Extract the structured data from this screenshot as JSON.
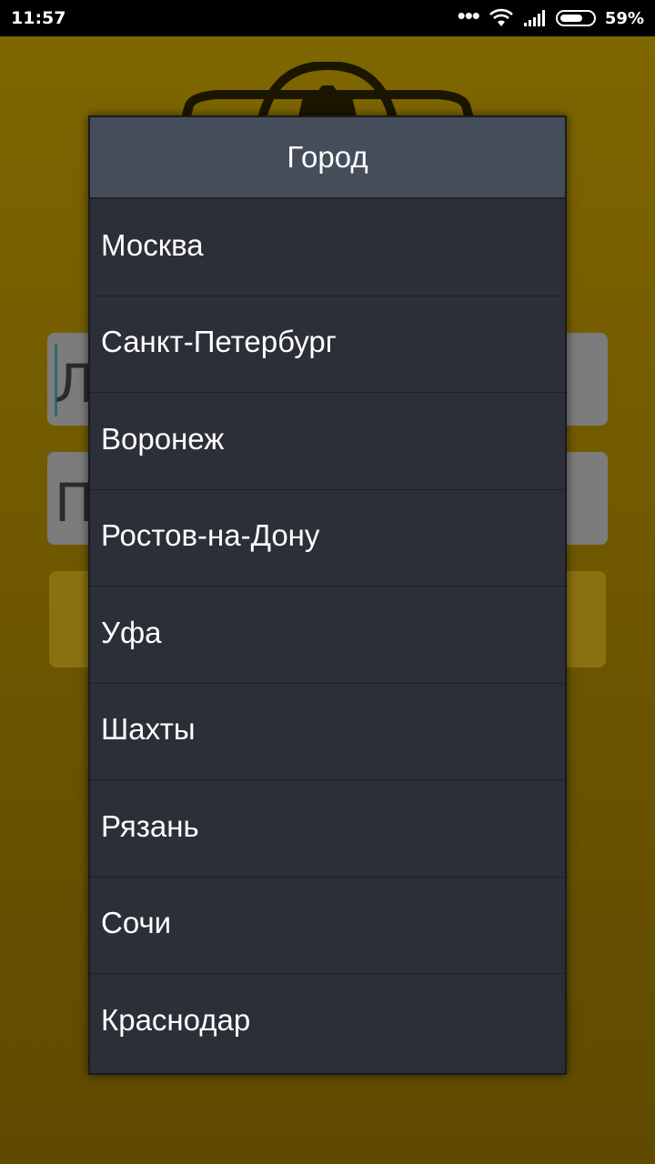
{
  "status_bar": {
    "time": "11:57",
    "battery_percent": "59%",
    "battery_level": 0.59
  },
  "background_app": {
    "login_field_partial": "Л",
    "password_field_partial": "П"
  },
  "dialog": {
    "title": "Город",
    "cities": [
      "Москва",
      "Санкт-Петербург",
      "Воронеж",
      "Ростов-на-Дону",
      "Уфа",
      "Шахты",
      "Рязань",
      "Сочи",
      "Краснодар"
    ]
  },
  "colors": {
    "app_background": "#6b5400",
    "dialog_background": "#2c2f37",
    "dialog_title_background": "#454d5a"
  },
  "icons": [
    "more-dots-icon",
    "wifi-icon",
    "signal-icon",
    "battery-icon",
    "taxi-logo-icon"
  ]
}
